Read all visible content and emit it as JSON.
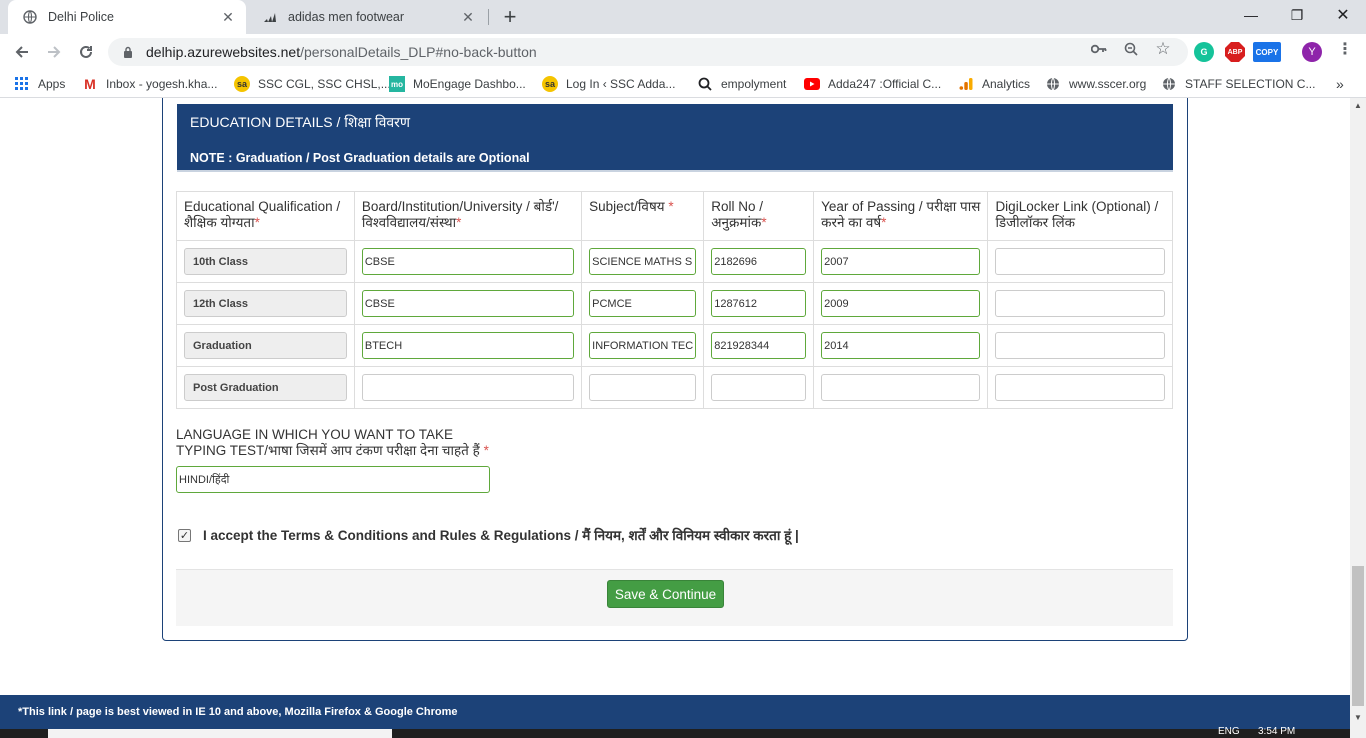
{
  "browser": {
    "tabs": [
      {
        "title": "Delhi Police",
        "active": true
      },
      {
        "title": "adidas men footwear",
        "active": false
      }
    ],
    "url_host": "delhip.azurewebsites.net",
    "url_path": "/personalDetails_DLP#no-back-button",
    "profile_initial": "Y",
    "bookmarks": [
      {
        "label": "Apps",
        "icon": "apps-grid-icon"
      },
      {
        "label": "Inbox - yogesh.kha...",
        "icon": "gmail-icon"
      },
      {
        "label": "SSC CGL, SSC CHSL,...",
        "icon": "sa-icon"
      },
      {
        "label": "MoEngage Dashbo...",
        "icon": "moengage-icon"
      },
      {
        "label": "Log In ‹ SSC Adda...",
        "icon": "sa-icon"
      },
      {
        "label": "empolyment",
        "icon": "search-icon"
      },
      {
        "label": "Adda247 :Official C...",
        "icon": "youtube-icon"
      },
      {
        "label": "Analytics",
        "icon": "analytics-icon"
      },
      {
        "label": "www.sscer.org",
        "icon": "globe-icon"
      },
      {
        "label": "STAFF SELECTION C...",
        "icon": "globe-icon"
      }
    ],
    "ext_labels": {
      "abp": "ABP",
      "copy": "COPY"
    }
  },
  "section": {
    "heading": "EDUCATION DETAILS / शिक्षा विवरण",
    "note": "NOTE : Graduation / Post Graduation details are Optional"
  },
  "table": {
    "headers": {
      "qualification": "Educational Qualification / शैक्षिक योग्यता",
      "board": "Board/Institution/University / बोर्ड'/ विश्वविद्यालय/संस्था",
      "subject": "Subject/विषय",
      "roll": "Roll No / अनुक्रमांक",
      "year": "Year of Passing / परीक्षा पास करने का वर्ष",
      "digilocker": "DigiLocker Link (Optional) / डिजीलॉकर लिंक"
    },
    "rows": [
      {
        "qualification": "10th Class",
        "board": "CBSE",
        "subject": "SCIENCE MATHS S",
        "roll": "2182696",
        "year": "2007",
        "digilocker": ""
      },
      {
        "qualification": "12th Class",
        "board": "CBSE",
        "subject": "PCMCE",
        "roll": "1287612",
        "year": "2009",
        "digilocker": ""
      },
      {
        "qualification": "Graduation",
        "board": "BTECH",
        "subject": "INFORMATION TEC",
        "roll": "821928344",
        "year": "2014",
        "digilocker": ""
      },
      {
        "qualification": "Post Graduation",
        "board": "",
        "subject": "",
        "roll": "",
        "year": "",
        "digilocker": ""
      }
    ]
  },
  "language": {
    "label": "LANGUAGE IN WHICH YOU WANT TO TAKE TYPING TEST/भाषा जिसमें आप टंकण परीक्षा देना चाहते हैं",
    "value": "HINDI/हिंदी"
  },
  "terms": {
    "label": "I accept the Terms & Conditions and Rules & Regulations / मैं नियम, शर्तें और विनियम स्वीकार करता हूं |",
    "checked": true
  },
  "actions": {
    "save_label": "Save & Continue"
  },
  "footer": {
    "text": "*This link / page is best viewed in IE 10 and above, Mozilla Firefox & Google Chrome"
  },
  "taskbar": {
    "lang": "ENG",
    "time": "3:54 PM"
  },
  "colors": {
    "header_blue": "#1c4278",
    "success_green": "#449d44",
    "required_red": "#d9534f",
    "valid_border": "#5fa83b"
  }
}
